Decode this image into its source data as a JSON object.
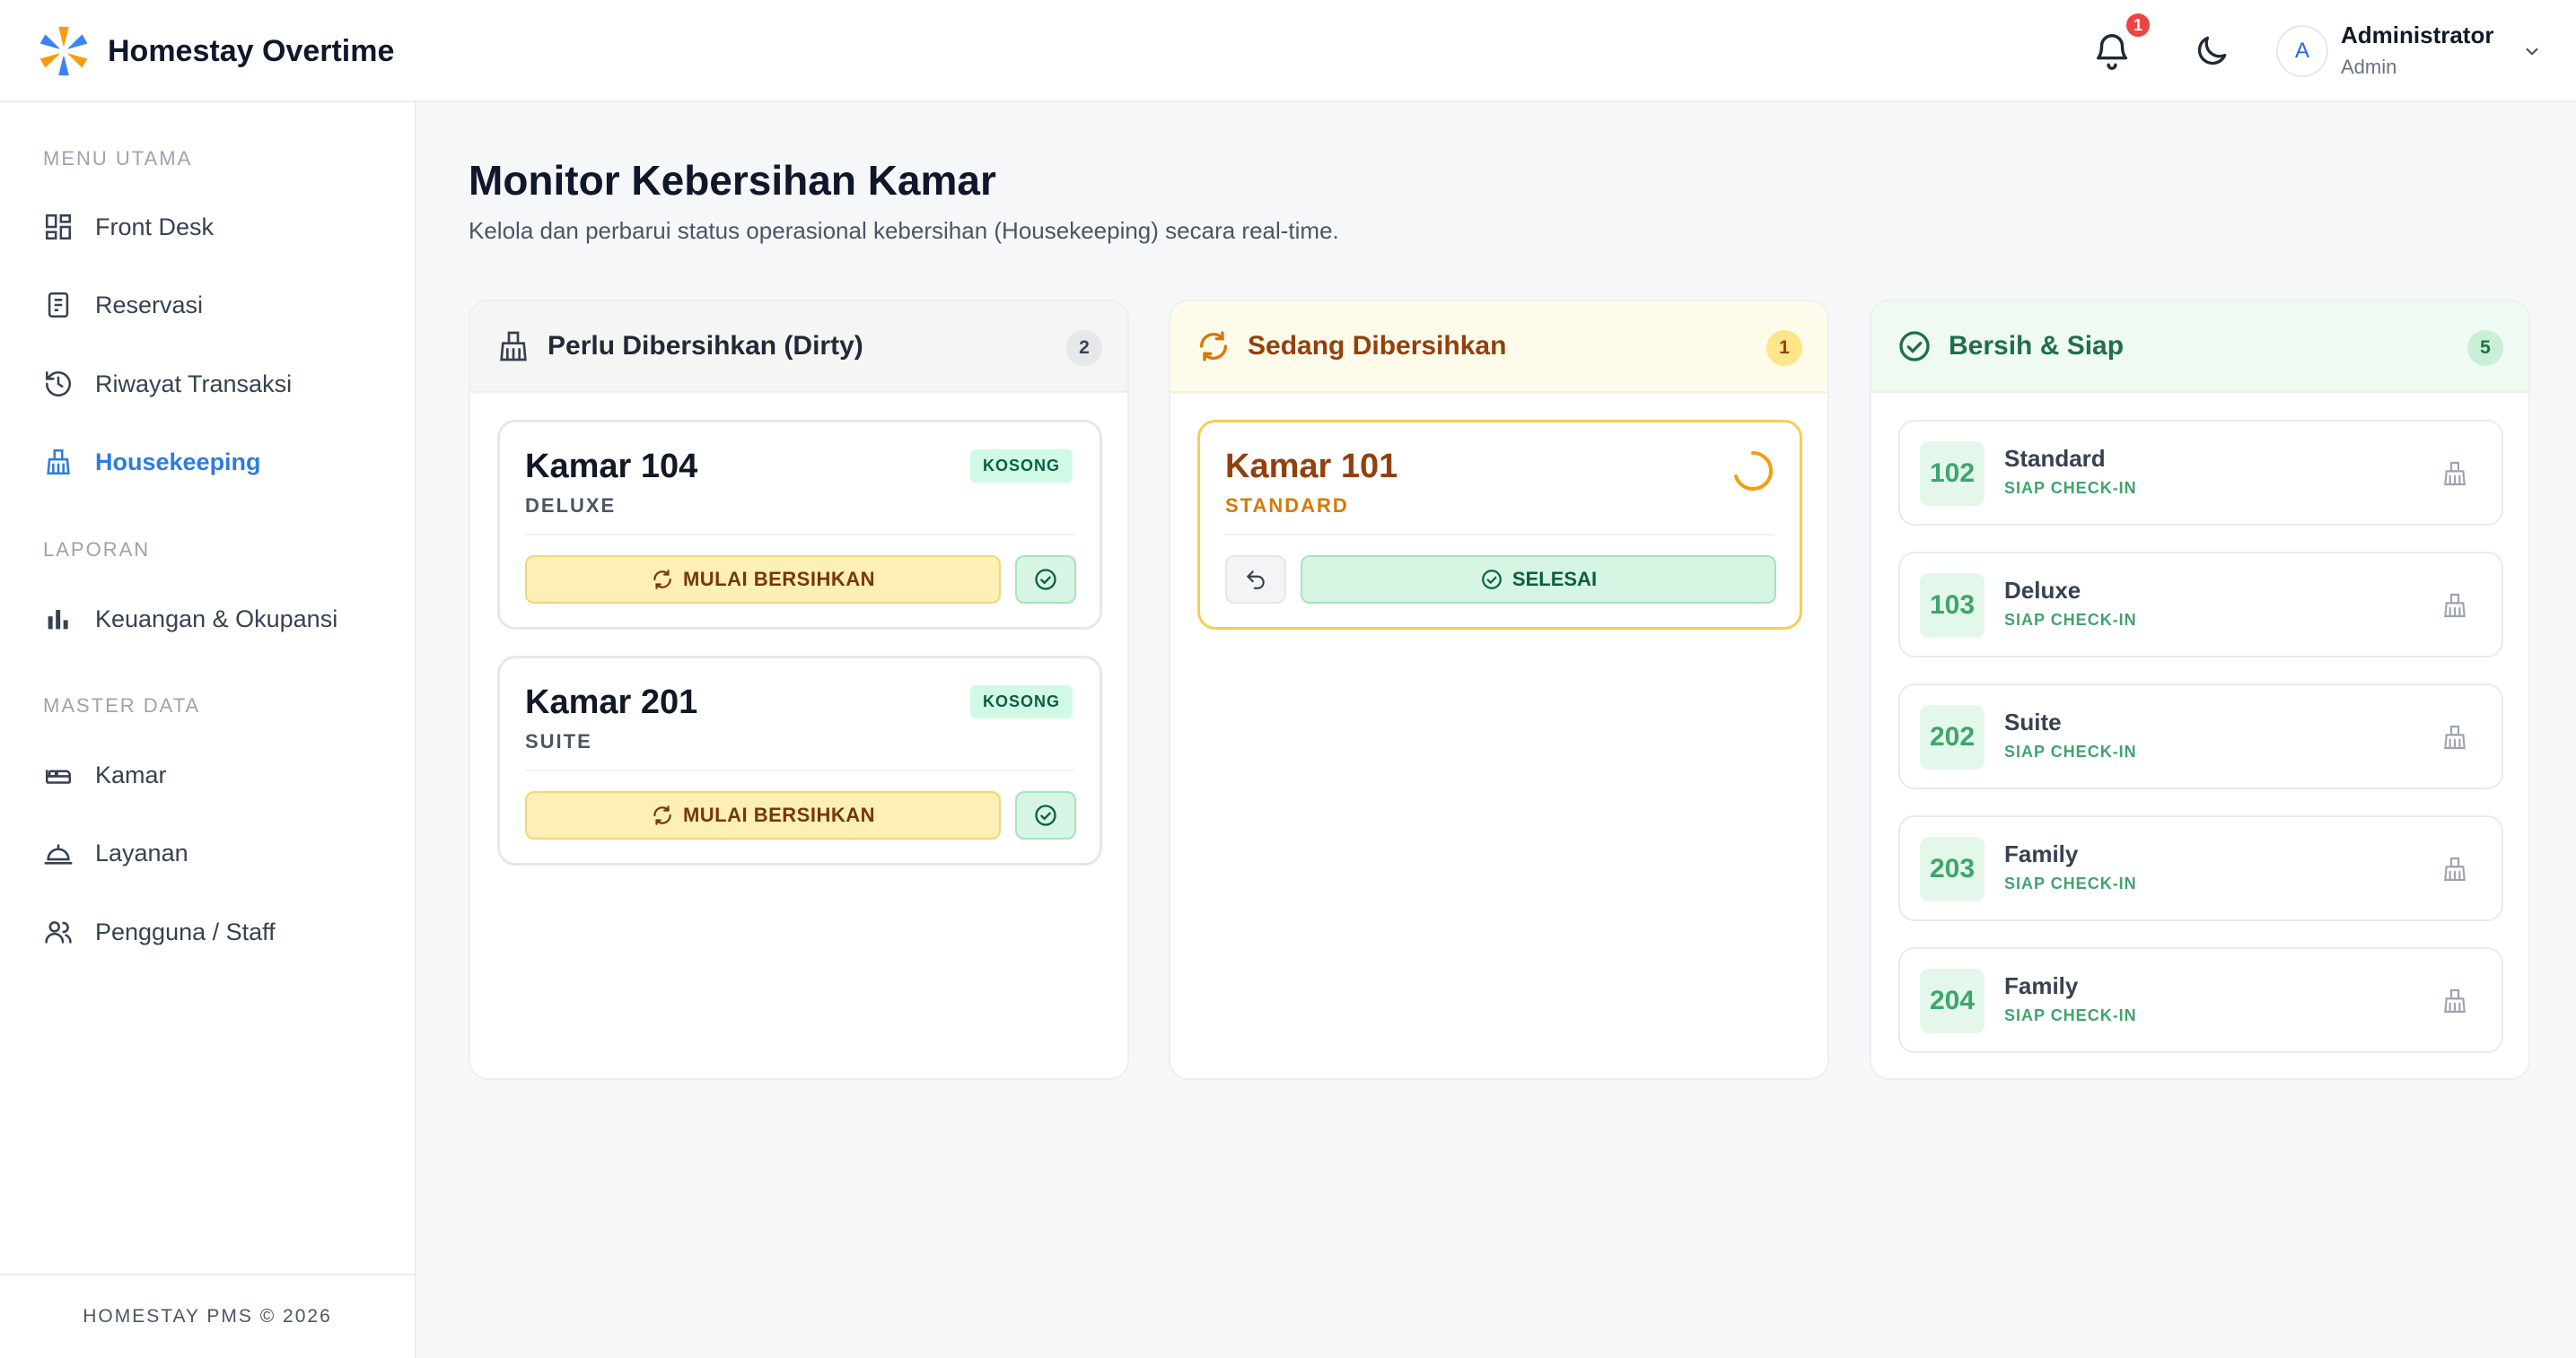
{
  "app": {
    "title": "Homestay Overtime"
  },
  "header": {
    "notification_count": "1",
    "user": {
      "initial": "A",
      "name": "Administrator",
      "role": "Admin"
    }
  },
  "sidebar": {
    "sections": [
      {
        "title": "MENU UTAMA"
      },
      {
        "title": "LAPORAN"
      },
      {
        "title": "MASTER DATA"
      }
    ],
    "items": [
      {
        "label": "Front Desk",
        "icon": "dashboard-icon"
      },
      {
        "label": "Reservasi",
        "icon": "reservation-icon"
      },
      {
        "label": "Riwayat Transaksi",
        "icon": "history-icon"
      },
      {
        "label": "Housekeeping",
        "icon": "broom-icon",
        "active": true
      },
      {
        "label": "Keuangan & Okupansi",
        "icon": "bar-chart-icon"
      },
      {
        "label": "Kamar",
        "icon": "bed-icon"
      },
      {
        "label": "Layanan",
        "icon": "service-bell-icon"
      },
      {
        "label": "Pengguna / Staff",
        "icon": "users-icon"
      }
    ],
    "footer": "HOMESTAY PMS © 2026"
  },
  "main": {
    "title": "Monitor Kebersihan Kamar",
    "subtitle": "Kelola dan perbarui status operasional kebersihan (Housekeeping) secara real-time."
  },
  "columns": {
    "dirty": {
      "title": "Perlu Dibersihkan (Dirty)",
      "count": "2",
      "rooms": [
        {
          "name": "Kamar 104",
          "type": "DELUXE",
          "badge": "KOSONG",
          "action": "MULAI BERSIHKAN"
        },
        {
          "name": "Kamar 201",
          "type": "SUITE",
          "badge": "KOSONG",
          "action": "MULAI BERSIHKAN"
        }
      ]
    },
    "progress": {
      "title": "Sedang Dibersihkan",
      "count": "1",
      "rooms": [
        {
          "name": "Kamar 101",
          "type": "STANDARD",
          "action": "SELESAI"
        }
      ]
    },
    "clean": {
      "title": "Bersih & Siap",
      "count": "5",
      "rooms": [
        {
          "number": "102",
          "type": "Standard",
          "status": "SIAP CHECK-IN"
        },
        {
          "number": "103",
          "type": "Deluxe",
          "status": "SIAP CHECK-IN"
        },
        {
          "number": "202",
          "type": "Suite",
          "status": "SIAP CHECK-IN"
        },
        {
          "number": "203",
          "type": "Family",
          "status": "SIAP CHECK-IN"
        },
        {
          "number": "204",
          "type": "Family",
          "status": "SIAP CHECK-IN"
        }
      ]
    }
  },
  "colors": {
    "accent": "#2f7be0",
    "dirty": "#fdefb5",
    "progress": "#f6cd52",
    "clean": "#3fa46d",
    "alert": "#ef4444"
  }
}
